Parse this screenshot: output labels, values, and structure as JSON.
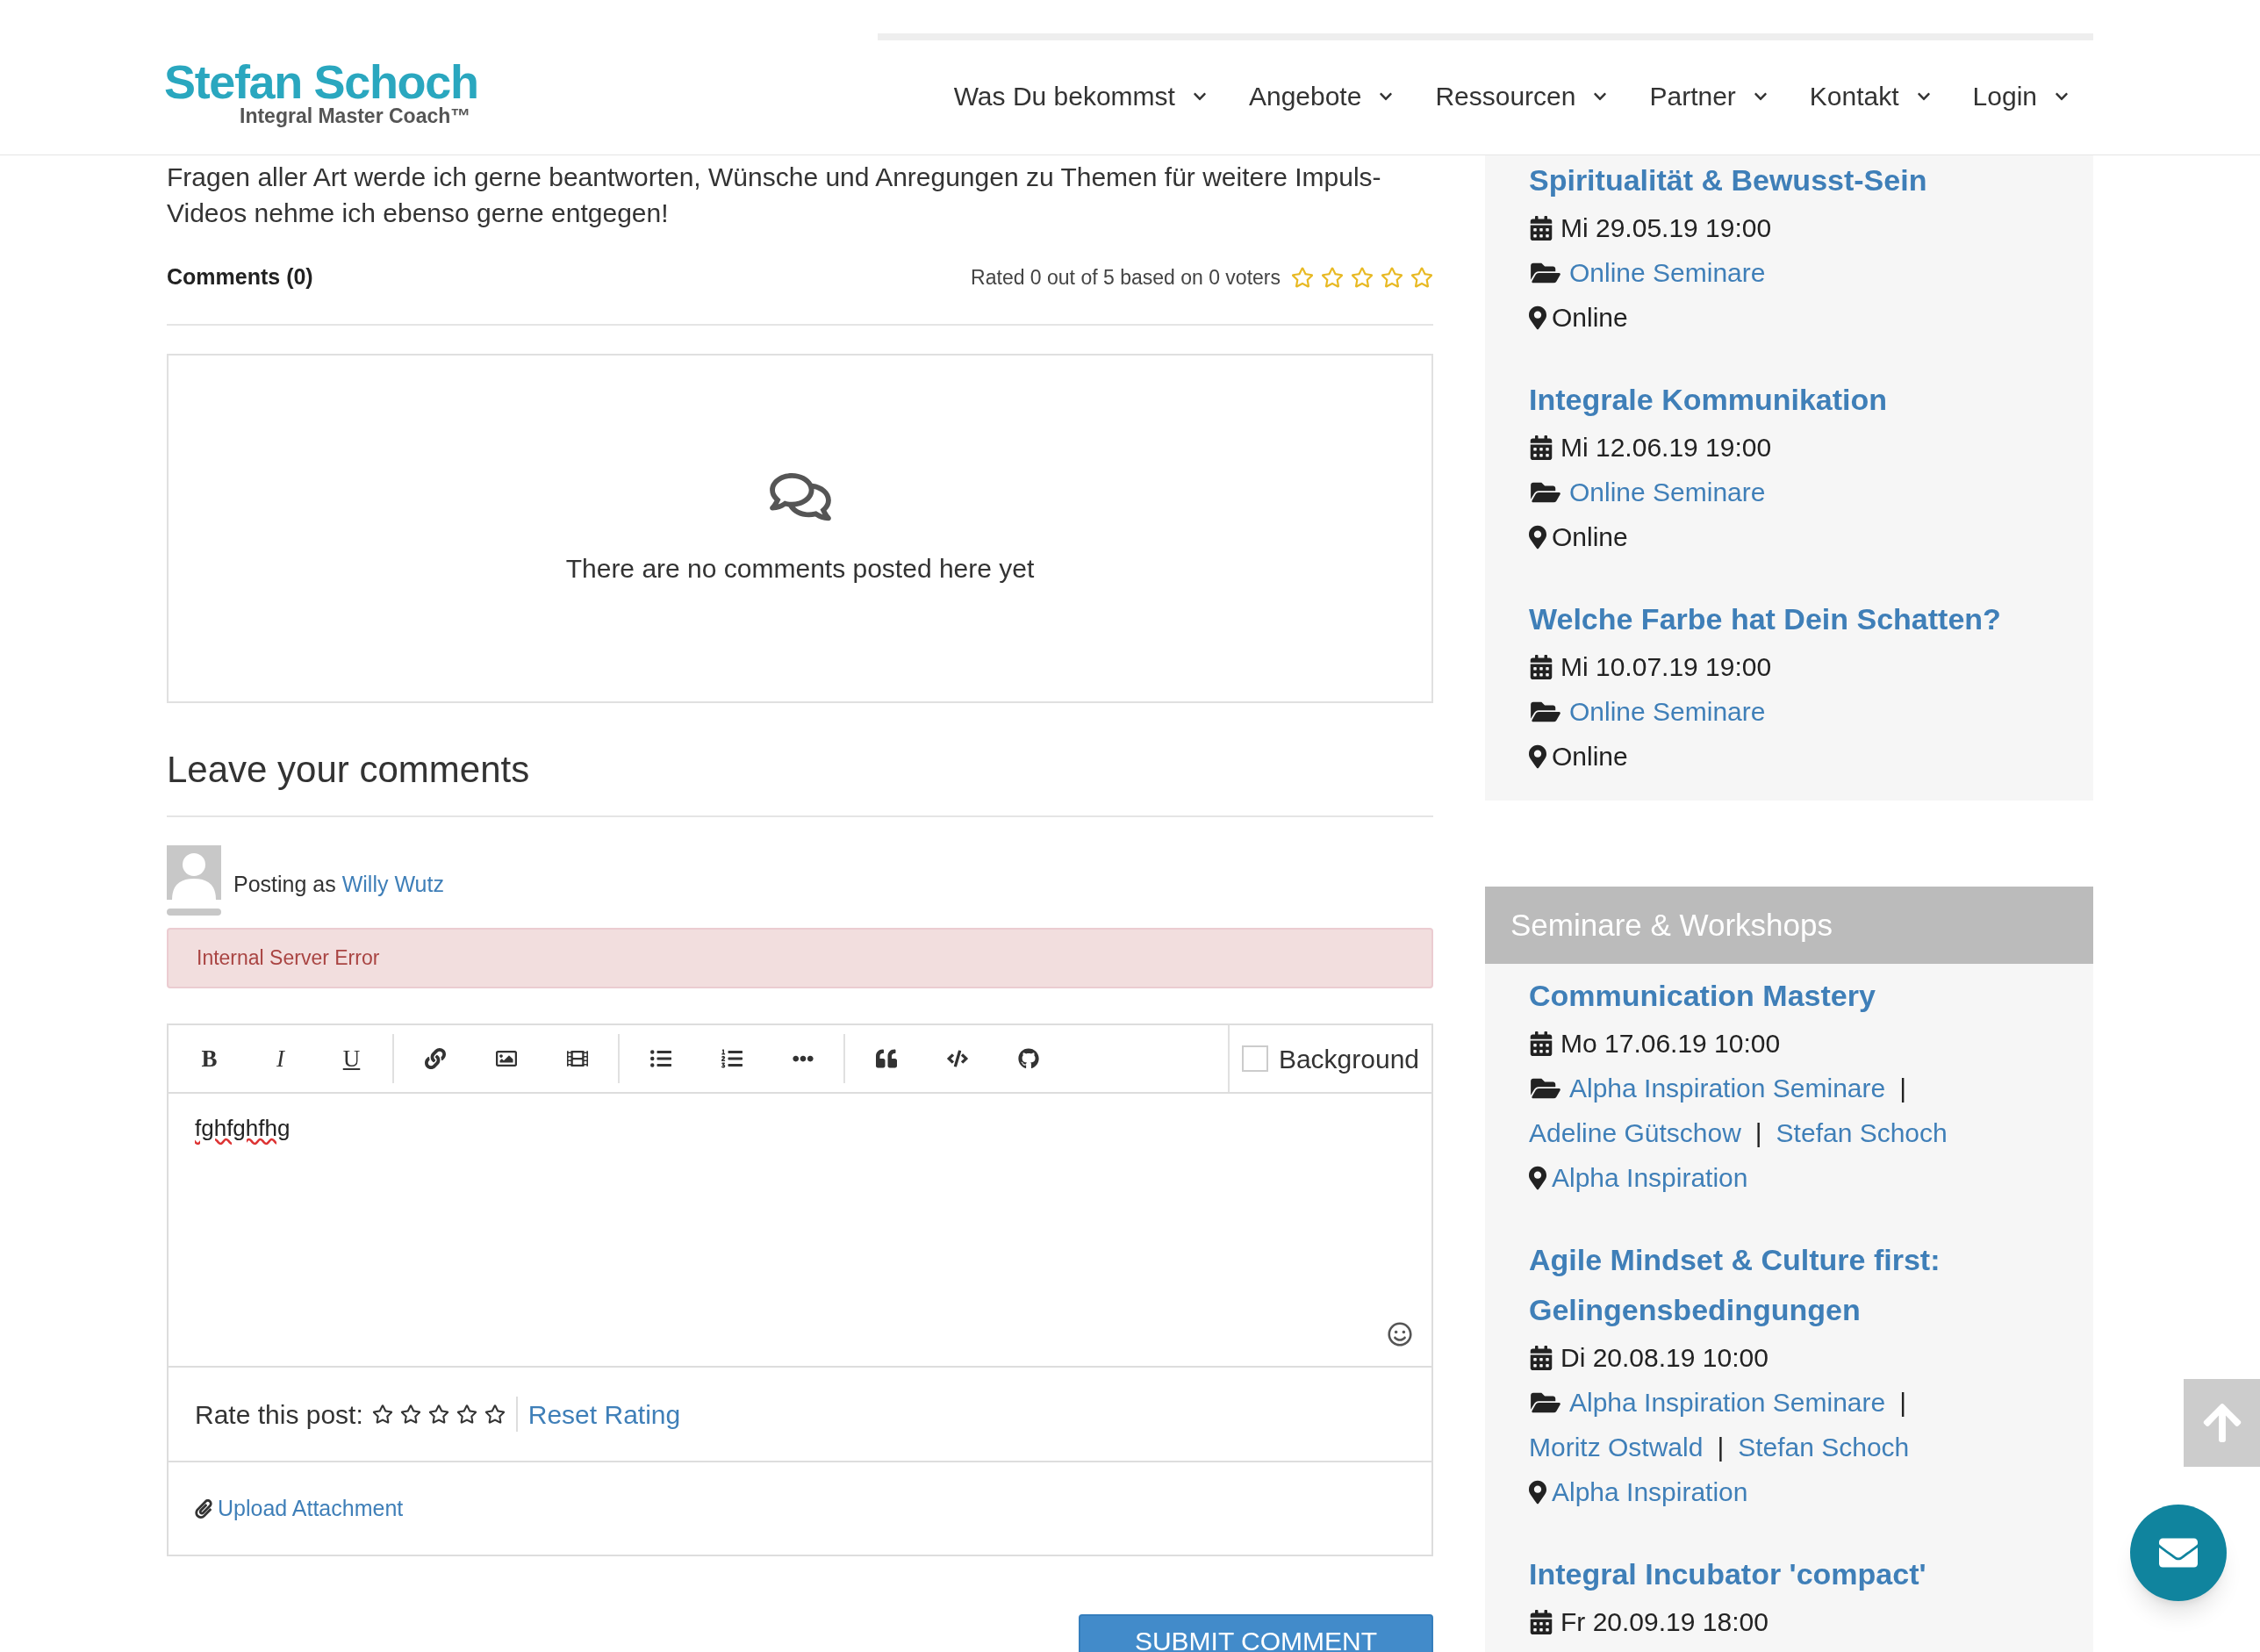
{
  "header": {
    "logo_title": "Stefan Schoch",
    "logo_subtitle": "Integral Master Coach™",
    "nav": [
      {
        "label": "Was Du bekommst"
      },
      {
        "label": "Angebote"
      },
      {
        "label": "Ressourcen"
      },
      {
        "label": "Partner"
      },
      {
        "label": "Kontakt"
      },
      {
        "label": "Login"
      }
    ]
  },
  "article": {
    "paragraph": "Fragen aller Art werde ich gerne beantworten, Wünsche und Anregungen zu Themen für weitere Impuls-Videos nehme ich ebenso gerne entgegen!",
    "comments_count": "Comments (0)",
    "rating_text": "Rated 0 out of 5 based on 0 voters",
    "stars": 0
  },
  "comments_empty": "There are no comments posted here yet",
  "form": {
    "heading": "Leave your comments",
    "posting_as": "Posting as",
    "user": "Willy Wutz",
    "error": "Internal Server Error",
    "toolbar_groups": [
      [
        {
          "kind": "bold",
          "label": "B"
        },
        {
          "kind": "italic",
          "label": "I"
        },
        {
          "kind": "underline",
          "label": "U"
        }
      ],
      [
        {
          "kind": "link"
        },
        {
          "kind": "image"
        },
        {
          "kind": "video"
        }
      ],
      [
        {
          "kind": "bullet-list"
        },
        {
          "kind": "numbered-list"
        },
        {
          "kind": "more"
        }
      ],
      [
        {
          "kind": "quote"
        },
        {
          "kind": "code"
        },
        {
          "kind": "github"
        }
      ]
    ],
    "background_label": "Background",
    "background_checked": false,
    "text": "fghfghfhg",
    "rate_label": "Rate this post:",
    "stars": 0,
    "reset": "Reset Rating",
    "upload": "Upload Attachment",
    "submit": "SUBMIT COMMENT"
  },
  "sidebar": {
    "events": [
      {
        "title": "Spiritualität & Bewusst-Sein",
        "date": "Mi 29.05.19 19:00",
        "category": "Online Seminare",
        "location": {
          "text": "Online",
          "linked": false
        }
      },
      {
        "title": "Integrale Kommunikation",
        "date": "Mi 12.06.19 19:00",
        "category": "Online Seminare",
        "location": {
          "text": "Online",
          "linked": false
        }
      },
      {
        "title": "Welche Farbe hat Dein Schatten?",
        "date": "Mi 10.07.19 19:00",
        "category": "Online Seminare",
        "location": {
          "text": "Online",
          "linked": false
        }
      }
    ],
    "section_title": "Seminare & Workshops",
    "separator": "|",
    "workshops": [
      {
        "title": "Communication Mastery",
        "date": "Mo 17.06.19 10:00",
        "category": "Alpha Inspiration Seminare",
        "people": [
          "Adeline Gütschow",
          "Stefan Schoch"
        ],
        "location": {
          "text": "Alpha Inspiration",
          "linked": true
        }
      },
      {
        "title": "Agile Mindset & Culture first: Gelingensbedingungen",
        "date": "Di 20.08.19 10:00",
        "category": "Alpha Inspiration Seminare",
        "people": [
          "Moritz Ostwald",
          "Stefan Schoch"
        ],
        "location": {
          "text": "Alpha Inspiration",
          "linked": true
        }
      },
      {
        "title": "Integral Incubator 'compact'",
        "date": "Fr 20.09.19 18:00"
      }
    ]
  }
}
